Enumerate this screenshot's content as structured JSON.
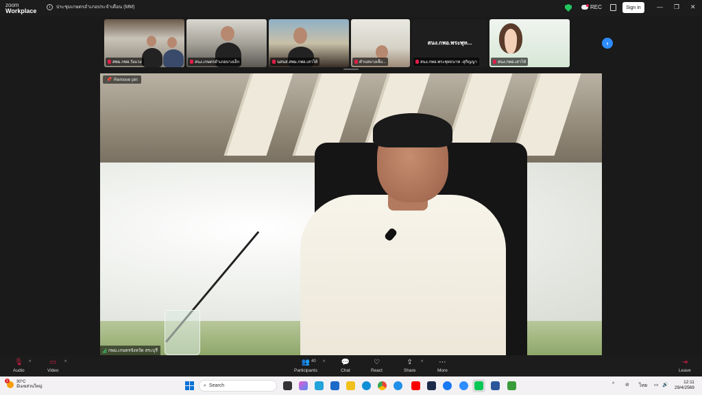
{
  "app": {
    "brand_top": "zoom",
    "brand_bottom": "Workplace"
  },
  "meeting": {
    "title": "ประชุมเกษตรอำเภอประจำเดือน (MM)"
  },
  "header": {
    "rec_label": "REC",
    "sign_in_label": "Sign in",
    "minimize": "—",
    "restore": "❐",
    "close": "✕"
  },
  "thumbnails": [
    {
      "name": "สพม.กพอ.วังแวง"
    },
    {
      "name": "สนง.เกษตรอำเภอบางเล็ก"
    },
    {
      "name": "นสนส.สพม.กพอ.เสาไห้"
    },
    {
      "name": "ตำบลบางเซ็ง..."
    },
    {
      "name": "สนง.กพอ.พระพุทธบาท -สุกิญญา",
      "display": "สนง.กพอ.พระพุท..."
    },
    {
      "name": "สนง.กพอ.เสาไห้"
    }
  ],
  "main_video": {
    "pin_label": "Remove pin",
    "speaker_name": "กพม.เกษตรจังหวัด สระบุรี"
  },
  "toolbar": {
    "audio": "Audio",
    "video": "Video",
    "participants": "Participants",
    "participants_count": "40",
    "chat": "Chat",
    "react": "React",
    "share": "Share",
    "more": "More",
    "leave": "Leave"
  },
  "taskbar": {
    "weather_temp": "30°C",
    "weather_desc": "มีเมฆส่วนใหญ่",
    "weather_badge": "1",
    "search_placeholder": "Search",
    "language": "ไทย",
    "time": "12:11",
    "date": "29/4/2569"
  },
  "colors": {
    "accent": "#2d8cff",
    "secure": "#22c55e",
    "alert": "#e11d48"
  }
}
